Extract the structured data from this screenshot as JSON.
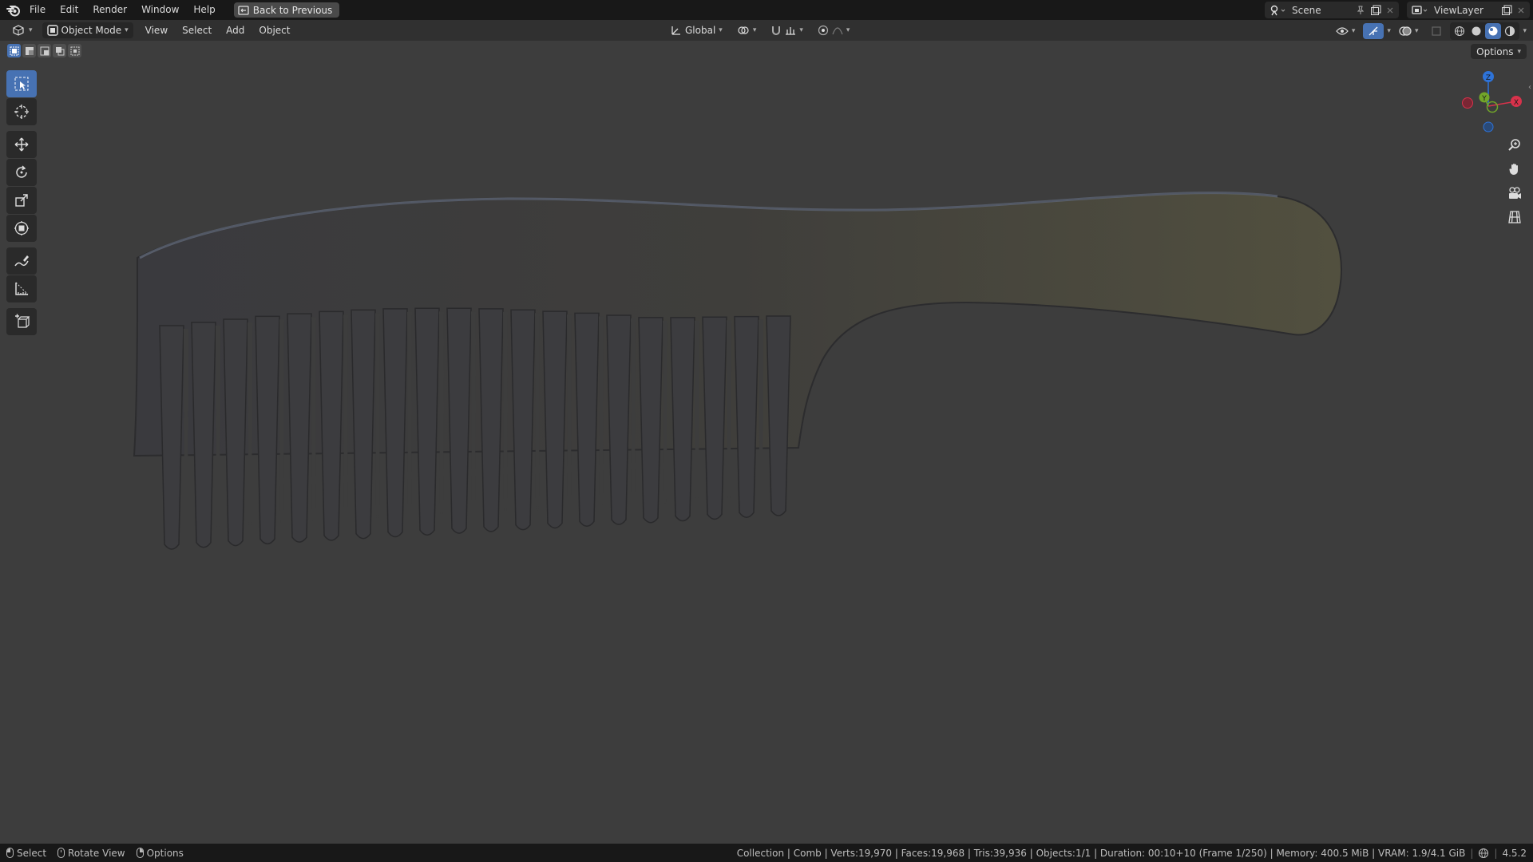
{
  "app": {
    "name": "Blender"
  },
  "menu": {
    "items": [
      "File",
      "Edit",
      "Render",
      "Window",
      "Help"
    ],
    "back_button": "Back to Previous"
  },
  "scene": {
    "name": "Scene"
  },
  "view_layer": {
    "name": "ViewLayer"
  },
  "header": {
    "mode": "Object Mode",
    "menus": [
      "View",
      "Select",
      "Add",
      "Object"
    ],
    "transform_orientation": "Global",
    "options_label": "Options"
  },
  "gizmo": {
    "axes": [
      {
        "label": "Z",
        "color": "#2e73d8"
      },
      {
        "label": "Y",
        "color": "#72a629"
      },
      {
        "label": "X",
        "color": "#d8324b"
      }
    ]
  },
  "toolbar": {
    "tools": [
      "select-box-icon",
      "cursor-icon",
      "move-icon",
      "rotate-icon",
      "scale-icon",
      "transform-icon",
      "annotate-icon",
      "measure-icon",
      "add-cube-icon"
    ],
    "active_tool": "select-box-icon"
  },
  "viewport": {
    "object_name": "Comb",
    "background_color": "#3d3d3d"
  },
  "status": {
    "hints": [
      "Select",
      "Rotate View",
      "Options"
    ],
    "stats": "Collection | Comb | Verts:19,970 | Faces:19,968 | Tris:39,936 | Objects:1/1 | Duration: 00:10+10 (Frame 1/250) | Memory: 400.5 MiB | VRAM: 1.9/4.1 GiB",
    "version": "4.5.2"
  },
  "colors": {
    "accent": "#4772b3",
    "topbar": "#181818",
    "header": "#303030"
  }
}
